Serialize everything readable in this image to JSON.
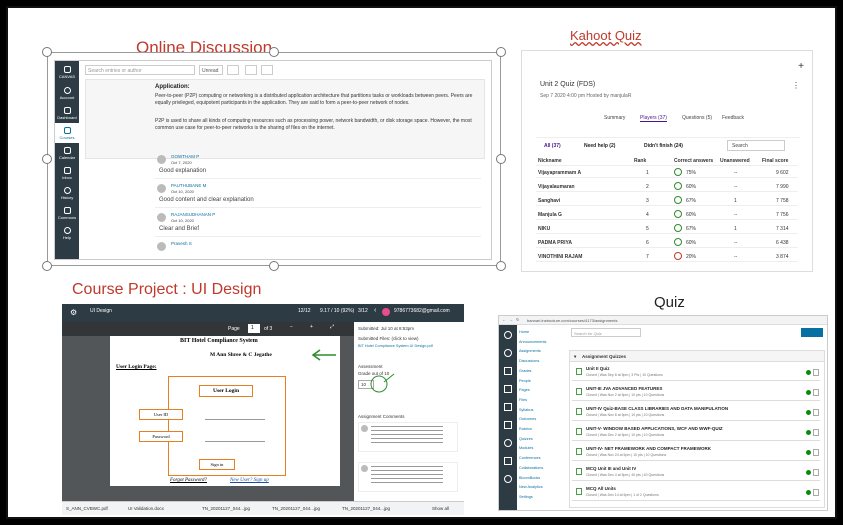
{
  "captions": {
    "online_discussion": "Online Discussion",
    "kahoot": "Kahoot Quiz",
    "course_project": "Course Project : UI Design",
    "quiz": "Quiz"
  },
  "discussion": {
    "search_placeholder": "Search entries or author",
    "unread": "Unread",
    "heading": "Application:",
    "para1": "Peer-to-peer (P2P) computing or networking is a distributed application architecture that partitions tasks or workloads between peers. Peers are equally privileged, equipotent participants in the application. They are said to form a peer-to-peer network of nodes.",
    "para2": "P2P is used to share all kinds of computing resources such as processing power, network bandwidth, or disk storage space. However, the most common use case for peer-to-peer networks is the sharing of files on the internet.",
    "replies": [
      {
        "name": "GOWTHAM P",
        "date": "Oct 7, 2020",
        "text": "Good explanation"
      },
      {
        "name": "PAUTHUBANE M",
        "date": "Oct 10, 2020",
        "text": "Good content and clear explanation"
      },
      {
        "name": "RAJANSUDHANAN P",
        "date": "Oct 10, 2020",
        "text": "Clear and Brief"
      },
      {
        "name": "Pravesh S",
        "date": "",
        "text": ""
      }
    ],
    "nav": [
      "Account",
      "Dashboard",
      "Courses",
      "Calendar",
      "Inbox",
      "History",
      "Commons",
      "Help"
    ],
    "logo": "CANVAS"
  },
  "kahoot": {
    "title": "Unit 2 Quiz (FDS)",
    "hosted": "Sep 7 2020 4:00 pm  Hosted by manjulaR",
    "tabs": [
      "Summary",
      "Players (37)",
      "Questions (5)",
      "Feedback"
    ],
    "filters": [
      "All (37)",
      "Need help (2)",
      "Didn't finish (24)"
    ],
    "search": "Search",
    "cols": [
      "Nickname",
      "Rank",
      "Correct answers",
      "Unanswered",
      "Final score"
    ],
    "rows": [
      {
        "name": "Vijayaprammam A",
        "rank": "1",
        "pct": "75%",
        "un": "--",
        "score": "9 602"
      },
      {
        "name": "Vijayalaumaran",
        "rank": "2",
        "pct": "60%",
        "un": "--",
        "score": "7 990"
      },
      {
        "name": "Sanghavi",
        "rank": "3",
        "pct": "67%",
        "un": "1",
        "score": "7 758"
      },
      {
        "name": "Manjula G",
        "rank": "4",
        "pct": "60%",
        "un": "--",
        "score": "7 756"
      },
      {
        "name": "NIKU",
        "rank": "5",
        "pct": "67%",
        "un": "1",
        "score": "7 314"
      },
      {
        "name": "PADMA PRIYA",
        "rank": "6",
        "pct": "60%",
        "un": "--",
        "score": "6 438"
      },
      {
        "name": "VINOTHINI RAJAM",
        "rank": "7",
        "pct": "20%",
        "un": "--",
        "score": "3 874"
      }
    ]
  },
  "project": {
    "app": "UI Design",
    "score_top": "12/12",
    "score2": "9.17 / 10 (92%)",
    "count": "3/12",
    "email": "9786773682@gmail.com",
    "page_label": "Page",
    "page_num": "1",
    "page_of": "of 3",
    "doc_title": "BIT Hotel Compliance System",
    "doc_author": "M Ann Shree & C Jegathe",
    "login_page": "User Login Page:",
    "user_login": "User Login",
    "user_id": "User ID",
    "password": "Password",
    "sign_in": "Sign in",
    "forgot": "Forgot Password?",
    "new_user": "New User? Sign up",
    "submitted": "Submitted: Jul 10 at 8:53pm",
    "submitted_files": "Submitted Files: (click to view)",
    "file": "BIT Hotel Compliance System UI Design.pdf",
    "assessment": "Assessment",
    "out_of": "Grade out of 10",
    "grade": "10",
    "comments_label": "Assignment Comments",
    "downloads": [
      "S_ANN_CVBWC.pdf",
      "UI Validation.docx",
      "TN_20201127_044...jpg",
      "TN_20201127_044...jpg",
      "TN_20201127_044...jpg"
    ],
    "show_all": "Show all"
  },
  "quiz": {
    "url": "bannari.instructure.com/courses/4173/assignments",
    "search_placeholder": "Search for Quiz",
    "group": "Assignment Quizzes",
    "nav": [
      "Home",
      "Announcements",
      "Assignments",
      "Discussions",
      "Grades",
      "People",
      "Pages",
      "Files",
      "Syllabus",
      "Outcomes",
      "Rubrics",
      "Quizzes",
      "Modules",
      "Conferences",
      "Collaborations",
      "BloomBooks",
      "New Analytics",
      "Settings"
    ],
    "items": [
      {
        "t": "Unit II Quiz",
        "s": "Closed | Was Sep 8 at 5pm | 3 Pts | 10 Questions"
      },
      {
        "t": "UNIT-III JVA ADVANCED FEATURES",
        "s": "Closed | Was Nov 2 at 5pm | 10 pts | 10 Questions"
      },
      {
        "t": "UNIT-IV Quiz-BASE CLASS LIBRARIES AND DATA MANIPULATION",
        "s": "Closed | Was Nov 8 at 5pm | 10 pts | 10 Questions"
      },
      {
        "t": "UNIT-V- WINDOW BASED APPLICATIONS, WCF AND WWF-QUIZ",
        "s": "Closed | Was Dec 2 at 5pm | 10 pts | 10 Questions"
      },
      {
        "t": "UNIT-IV- NET FRAMEWORK AND COMPACT FRAMEWORK",
        "s": "Closed | Was Nov 24 at 5pm | 10 pts | 10 Questions"
      },
      {
        "t": "MCQ Unit III and Unit IV",
        "s": "Closed | Was Dec 4 at 5pm | 40 pts | 40 Questions"
      },
      {
        "t": "MCQ All Units",
        "s": "Closed | Was Dec 14 at 5pm | 1 of 2 Questions"
      }
    ]
  },
  "colors": {
    "caption_red": "#c0392b",
    "canvas_nav": "#2d3b45",
    "accent_blue": "#0770a3",
    "green": "#2e8b2e"
  }
}
